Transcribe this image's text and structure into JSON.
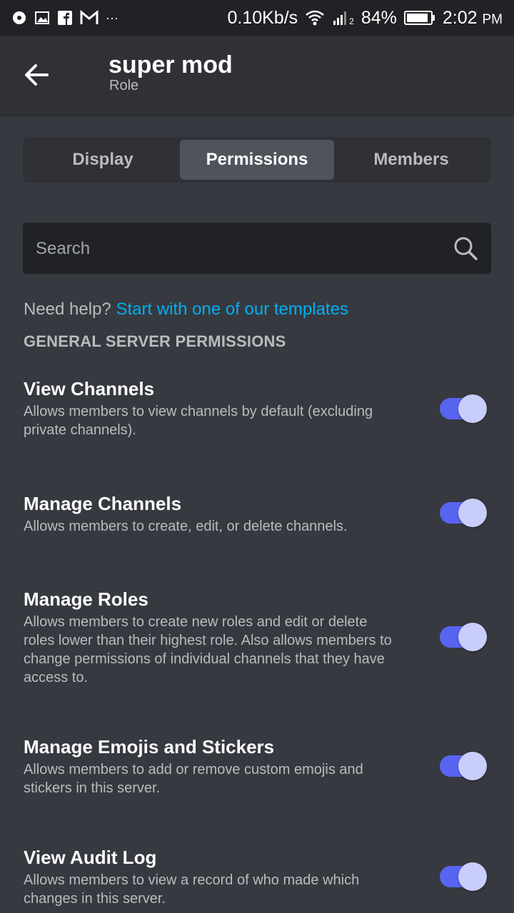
{
  "status_bar": {
    "net_speed": "0.10Kb/s",
    "battery": "84%",
    "time": "2:02",
    "ampm": "PM",
    "overflow": "···",
    "signal_tag": "2"
  },
  "header": {
    "title": "super mod",
    "subtitle": "Role"
  },
  "tabs": [
    {
      "label": "Display",
      "active": false
    },
    {
      "label": "Permissions",
      "active": true
    },
    {
      "label": "Members",
      "active": false
    }
  ],
  "search": {
    "placeholder": "Search",
    "value": ""
  },
  "help": {
    "prefix": "Need help?",
    "link": "Start with one of our templates"
  },
  "section": {
    "title": "GENERAL SERVER PERMISSIONS"
  },
  "permissions": [
    {
      "name": "View Channels",
      "description": "Allows members to view channels by default (excluding private channels).",
      "enabled": true
    },
    {
      "name": "Manage Channels",
      "description": "Allows members to create, edit, or delete channels.",
      "enabled": true
    },
    {
      "name": "Manage Roles",
      "description": "Allows members to create new roles and edit or delete roles lower than their highest role. Also allows members to change permissions of individual channels that they have access to.",
      "enabled": true
    },
    {
      "name": "Manage Emojis and Stickers",
      "description": "Allows members to add or remove custom emojis and stickers in this server.",
      "enabled": true
    },
    {
      "name": "View Audit Log",
      "description": "Allows members to view a record of who made which changes in this server.",
      "enabled": true
    }
  ],
  "colors": {
    "background": "#36393f",
    "accent": "#5865f2",
    "link": "#00aff4"
  }
}
